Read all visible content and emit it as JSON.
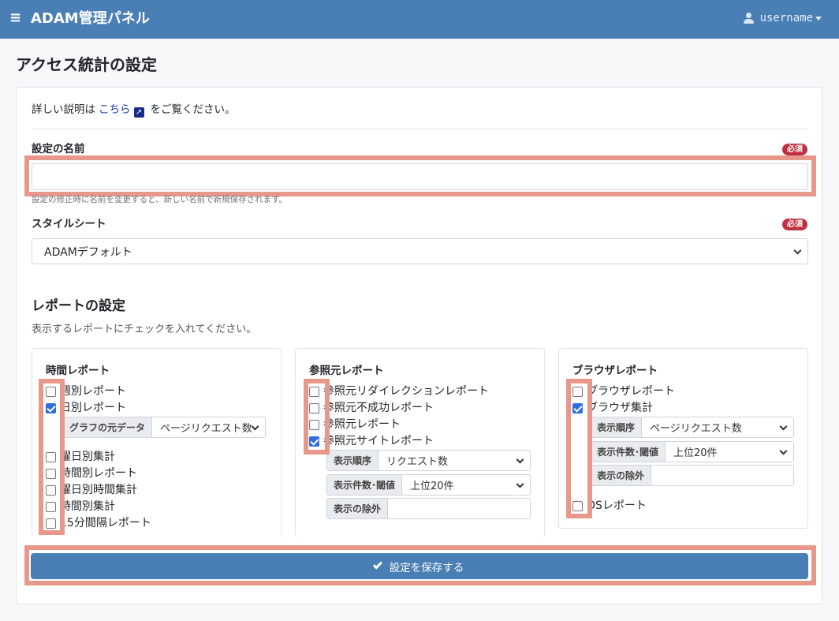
{
  "navbar": {
    "menu_icon": "hamburger-icon",
    "title": "ADAM管理パネル",
    "user": "username",
    "bg_color": "#4a7fb5"
  },
  "page": {
    "title": "アクセス統計の設定"
  },
  "help": {
    "prefix": "詳しい説明は",
    "link": "こちら",
    "suffix": "をご覧ください。"
  },
  "name_field": {
    "label": "設定の名前",
    "required": "必須",
    "value": "",
    "hint": "設定の修正時に名前を変更すると、新しい名前で新規保存されます。"
  },
  "stylesheet": {
    "label": "スタイルシート",
    "required": "必須",
    "selected": "ADAMデフォルト"
  },
  "reports": {
    "title": "レポートの設定",
    "subtitle": "表示するレポートにチェックを入れてください。",
    "panels": [
      {
        "title": "時間レポート",
        "items": [
          {
            "label": "週別レポート",
            "checked": false
          },
          {
            "label": "日別レポート",
            "checked": true
          },
          {
            "label": "曜日別集計",
            "checked": false
          },
          {
            "label": "時間別レポート",
            "checked": false
          },
          {
            "label": "曜日別時間集計",
            "checked": false
          },
          {
            "label": "時間別集計",
            "checked": false
          },
          {
            "label": "15分間隔レポート",
            "checked": false
          }
        ],
        "graph_source": {
          "label": "グラフの元データ",
          "value": "ページリクエスト数"
        }
      },
      {
        "title": "参照元レポート",
        "items": [
          {
            "label": "参照元リダイレクションレポート",
            "checked": false
          },
          {
            "label": "参照元不成功レポート",
            "checked": false
          },
          {
            "label": "参照元レポート",
            "checked": false
          },
          {
            "label": "参照元サイトレポート",
            "checked": true
          }
        ],
        "order": {
          "label": "表示順序",
          "value": "リクエスト数"
        },
        "count": {
          "label": "表示件数･閾値",
          "value": "上位20件"
        },
        "exclude": {
          "label": "表示の除外",
          "value": ""
        }
      },
      {
        "title": "ブラウザレポート",
        "items": [
          {
            "label": "ブラウザレポート",
            "checked": false
          },
          {
            "label": "ブラウザ集計",
            "checked": true
          },
          {
            "label": "OSレポート",
            "checked": false
          }
        ],
        "order": {
          "label": "表示順序",
          "value": "ページリクエスト数"
        },
        "count": {
          "label": "表示件数･閾値",
          "value": "上位20件"
        },
        "exclude": {
          "label": "表示の除外",
          "value": ""
        }
      }
    ]
  },
  "save_button": {
    "label": "設定を保存する",
    "icon": "check-icon"
  },
  "colors": {
    "primary": "#4a7fb5",
    "required_badge": "#c0303f",
    "link": "#1a3cb0",
    "checkbox_checked": "#2f6de1",
    "highlight": "#e8988a"
  }
}
